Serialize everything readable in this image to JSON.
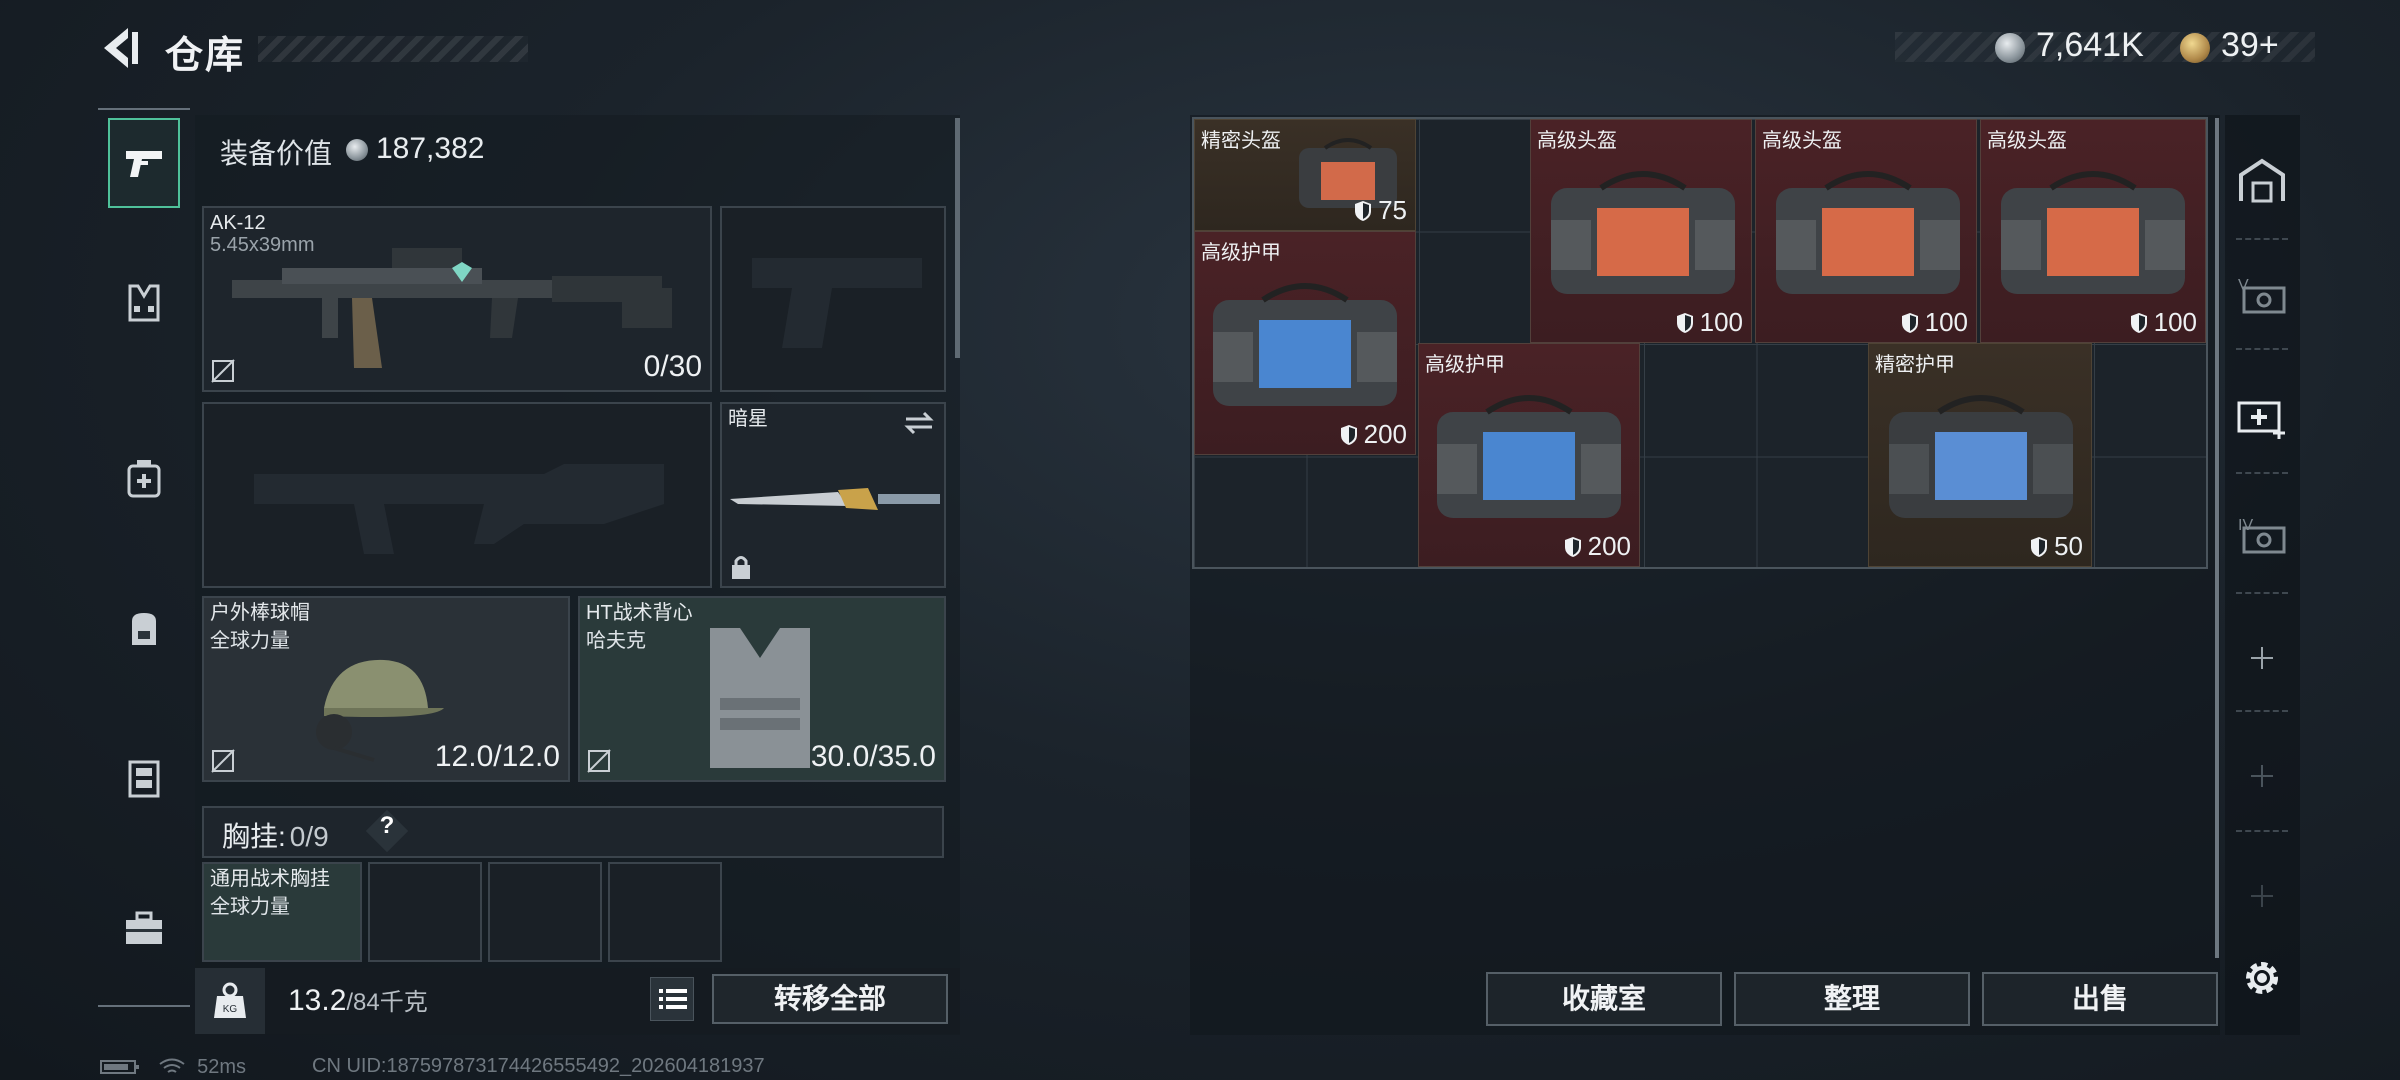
{
  "header": {
    "title": "仓库",
    "silver": "7,641K",
    "gold": "39+"
  },
  "left_tabs": [
    "weapon-tab",
    "armor-tab",
    "medical-tab",
    "backpack-tab",
    "chest-rig-tab",
    "toolbox-tab"
  ],
  "loadout": {
    "value_label": "装备价值",
    "value": "187,382",
    "primary": {
      "name": "AK-12",
      "ammo_type": "5.45x39mm",
      "ammo": "0/30"
    },
    "melee": {
      "name": "暗星"
    },
    "helmet": {
      "name": "户外棒球帽",
      "maker": "全球力量",
      "durability": "12.0/12.0"
    },
    "vest": {
      "name": "HT战术背心",
      "maker": "哈夫克",
      "durability": "30.0/35.0"
    },
    "chest_rig": {
      "label": "胸挂:",
      "count": "0/9",
      "help": "?"
    },
    "rig_item": {
      "name": "通用战术胸挂",
      "maker": "全球力量"
    },
    "weight": "13.2",
    "weight_max": "/84千克",
    "transfer_all": "转移全部"
  },
  "storage": {
    "items": [
      {
        "label": "精密头盔",
        "value": "75",
        "type": "helmet"
      },
      {
        "label": "高级头盔",
        "value": "100",
        "type": "helmet"
      },
      {
        "label": "高级头盔",
        "value": "100",
        "type": "helmet"
      },
      {
        "label": "高级头盔",
        "value": "100",
        "type": "helmet"
      },
      {
        "label": "高级护甲",
        "value": "200",
        "type": "armor"
      },
      {
        "label": "高级护甲",
        "value": "200",
        "type": "armor"
      },
      {
        "label": "精密护甲",
        "value": "50",
        "type": "armor"
      }
    ],
    "buttons": {
      "collection": "收藏室",
      "organize": "整理",
      "sell": "出售"
    }
  },
  "status": {
    "ping": "52ms",
    "uid": "CN UID:187597873174426555492_202604181937"
  },
  "colors": {
    "accent": "#4fc19a",
    "rare_red": "#4a2226",
    "rare_gold": "#3a3026"
  }
}
